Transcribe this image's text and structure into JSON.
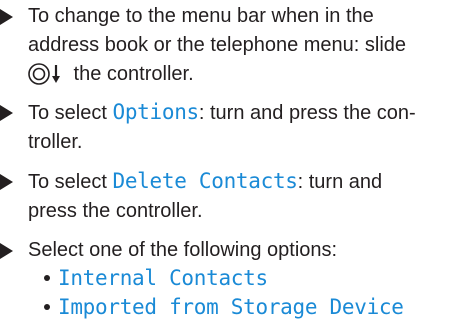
{
  "steps": [
    {
      "line1": "To change to the menu bar when in the",
      "line2": "address book or the telephone menu: slide",
      "line3_icon": "controller-slide-down-icon",
      "line3_text": " the controller."
    },
    {
      "prefix": "To select ",
      "highlight": "Options",
      "suffix": ": turn and press the con-",
      "line2": "troller."
    },
    {
      "prefix": "To select ",
      "highlight": "Delete Contacts",
      "suffix": ": turn and",
      "line2": "press the controller."
    },
    {
      "line1": "Select one of the following options:"
    }
  ],
  "options": [
    "Internal Contacts",
    "Imported from Storage Device"
  ],
  "colors": {
    "text": "#231f20",
    "highlight": "#1a8ad6"
  }
}
